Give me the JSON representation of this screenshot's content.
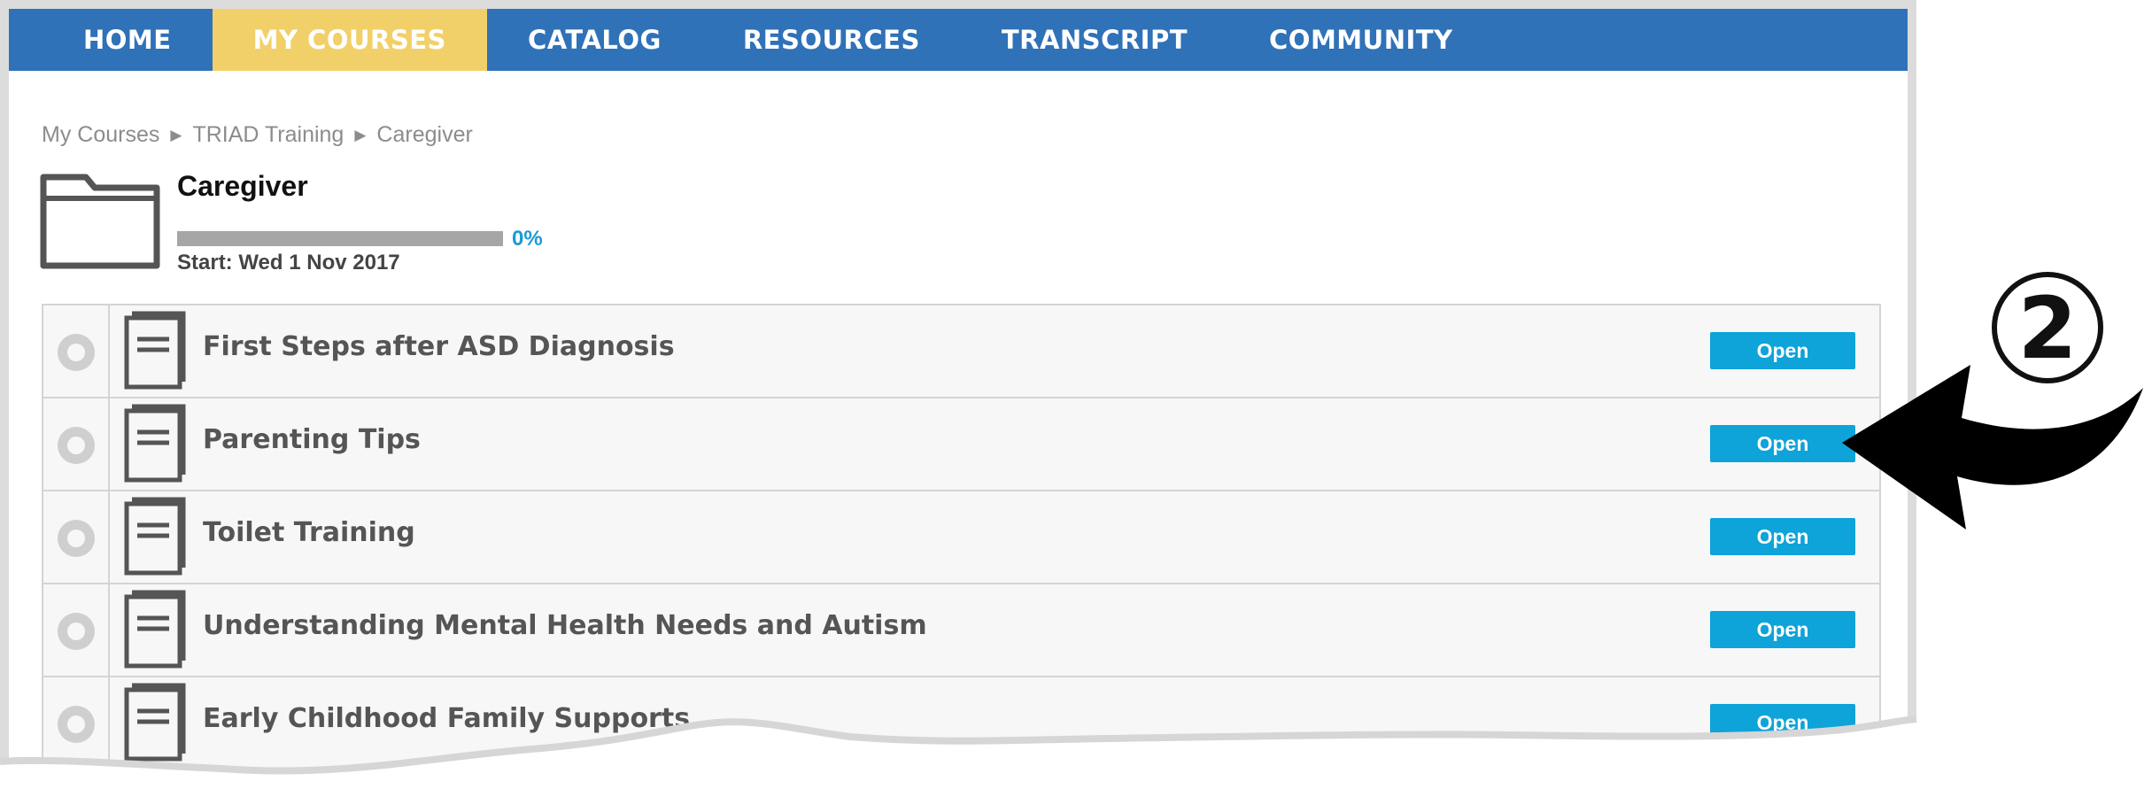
{
  "nav": {
    "items": [
      {
        "label": "HOME"
      },
      {
        "label": "MY COURSES"
      },
      {
        "label": "CATALOG"
      },
      {
        "label": "RESOURCES"
      },
      {
        "label": "TRANSCRIPT"
      },
      {
        "label": "COMMUNITY"
      }
    ],
    "active_index": 1,
    "bar_color": "#2f72b8",
    "active_color": "#f2d069"
  },
  "breadcrumb": [
    "My Courses",
    "TRIAD Training",
    "Caregiver"
  ],
  "course": {
    "title": "Caregiver",
    "progress_percent": 0,
    "progress_label": "0%",
    "start_label": "Start: Wed 1 Nov 2017",
    "icon": "folder-icon"
  },
  "modules": [
    {
      "title": "First Steps after ASD Diagnosis",
      "button": "Open",
      "icon": "document-icon"
    },
    {
      "title": "Parenting Tips",
      "button": "Open",
      "icon": "document-icon"
    },
    {
      "title": "Toilet Training",
      "button": "Open",
      "icon": "document-icon"
    },
    {
      "title": "Understanding Mental Health Needs and Autism",
      "button": "Open",
      "icon": "document-icon"
    },
    {
      "title": "Early Childhood Family Supports",
      "button": "Open",
      "icon": "document-icon"
    }
  ],
  "annotation": {
    "step_number": "2",
    "arrow_icon": "pointer-arrow-icon"
  },
  "colors": {
    "button": "#0ea3d9",
    "progress_label": "#1b9ad6"
  }
}
